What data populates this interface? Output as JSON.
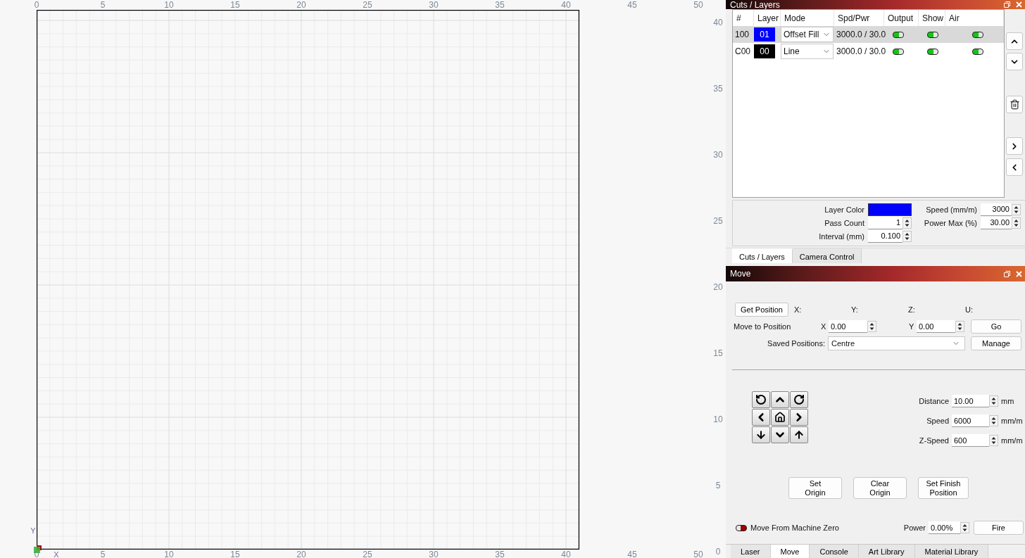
{
  "canvas": {
    "top_ruler": [
      "0",
      "5",
      "10",
      "15",
      "20",
      "25",
      "30",
      "35",
      "40",
      "45",
      "50"
    ],
    "right_ruler": [
      "40",
      "35",
      "30",
      "25",
      "20",
      "15",
      "10",
      "5",
      "0"
    ],
    "bottom_ruler": [
      "0",
      "5",
      "10",
      "15",
      "20",
      "25",
      "30",
      "35",
      "40",
      "45",
      "50"
    ],
    "y_axis_label": "Y",
    "x_axis_label": "X"
  },
  "cuts_layers": {
    "title": "Cuts / Layers",
    "columns": [
      "#",
      "Layer",
      "Mode",
      "Spd/Pwr",
      "Output",
      "Show",
      "Air"
    ],
    "rows": [
      {
        "number": "100",
        "layer": "01",
        "color": "#0000ff",
        "mode": "Offset Fill",
        "spd_pwr": "3000.0 / 30.0",
        "output": true,
        "show": true,
        "air": true,
        "selected": true
      },
      {
        "number": "C00",
        "layer": "00",
        "color": "#000000",
        "mode": "Line",
        "spd_pwr": "3000.0 / 30.0",
        "output": true,
        "show": true,
        "air": true,
        "selected": false
      }
    ]
  },
  "layer_settings": [
    {
      "label": "Layer Color",
      "kind": "color",
      "color": "#0000ff"
    },
    {
      "label": "Speed (mm/m)",
      "kind": "number",
      "value": "3000"
    },
    {
      "label": "Pass Count",
      "kind": "number",
      "value": "1"
    },
    {
      "label": "Power Max (%)",
      "kind": "number",
      "value": "30.00"
    },
    {
      "label": "Interval (mm)",
      "kind": "number",
      "value": "0.100"
    }
  ],
  "upper_tabs": [
    {
      "label": "Cuts / Layers",
      "selected": true
    },
    {
      "label": "Camera Control",
      "selected": false
    }
  ],
  "move": {
    "title": "Move",
    "get_position_button": "Get Position",
    "axes": [
      "X:",
      "Y:",
      "Z:",
      "U:"
    ],
    "move_to_label": "Move to Position",
    "targets": [
      {
        "axis": "X",
        "value": "0.00"
      },
      {
        "axis": "Y",
        "value": "0.00"
      }
    ],
    "go_button": "Go",
    "saved_label": "Saved Positions:",
    "saved_value": "Centre",
    "manage_button": "Manage",
    "jog_settings": [
      {
        "label": "Distance",
        "value": "10.00",
        "unit": "mm"
      },
      {
        "label": "Speed",
        "value": "6000",
        "unit": "mm/m"
      },
      {
        "label": "Z-Speed",
        "value": "600",
        "unit": "mm/m"
      }
    ],
    "action_buttons": [
      {
        "lines": [
          "Set",
          "Origin"
        ]
      },
      {
        "lines": [
          "Clear",
          "Origin"
        ]
      },
      {
        "lines": [
          "Set Finish",
          "Position"
        ]
      }
    ],
    "machine_zero": {
      "label": "Move From Machine Zero",
      "on": false
    },
    "power": {
      "label": "Power",
      "value": "0.00%"
    },
    "fire_button": "Fire"
  },
  "bottom_tabs": [
    {
      "label": "Laser",
      "selected": false
    },
    {
      "label": "Move",
      "selected": true
    },
    {
      "label": "Console",
      "selected": false
    },
    {
      "label": "Art Library",
      "selected": false
    },
    {
      "label": "Material Library",
      "selected": false
    }
  ]
}
